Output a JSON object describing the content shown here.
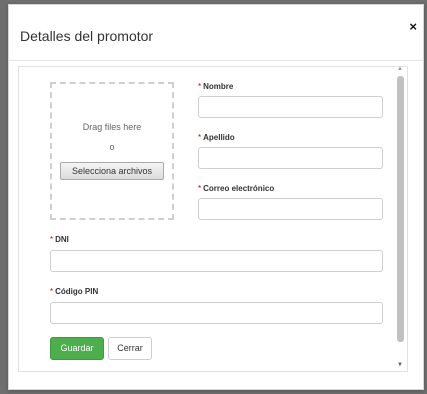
{
  "modal": {
    "title": "Detalles del promotor",
    "close_symbol": "×"
  },
  "dropzone": {
    "drag_text": "Drag files here",
    "or_text": "o",
    "button_label": "Selecciona archivos"
  },
  "fields": {
    "nombre": {
      "label": "Nombre",
      "value": ""
    },
    "apellido": {
      "label": "Apellido",
      "value": ""
    },
    "correo": {
      "label": "Correo electrónico",
      "value": ""
    },
    "dni": {
      "label": "DNI",
      "value": ""
    },
    "pin": {
      "label": "Código PIN",
      "value": ""
    }
  },
  "required_marker": "*",
  "buttons": {
    "save_label": "Guardar",
    "close_label": "Cerrar"
  },
  "scrollbar": {
    "up_icon": "▲",
    "down_icon": "▼"
  },
  "colors": {
    "save_button": "#4cae4c",
    "backdrop": "#6f6f6f"
  }
}
